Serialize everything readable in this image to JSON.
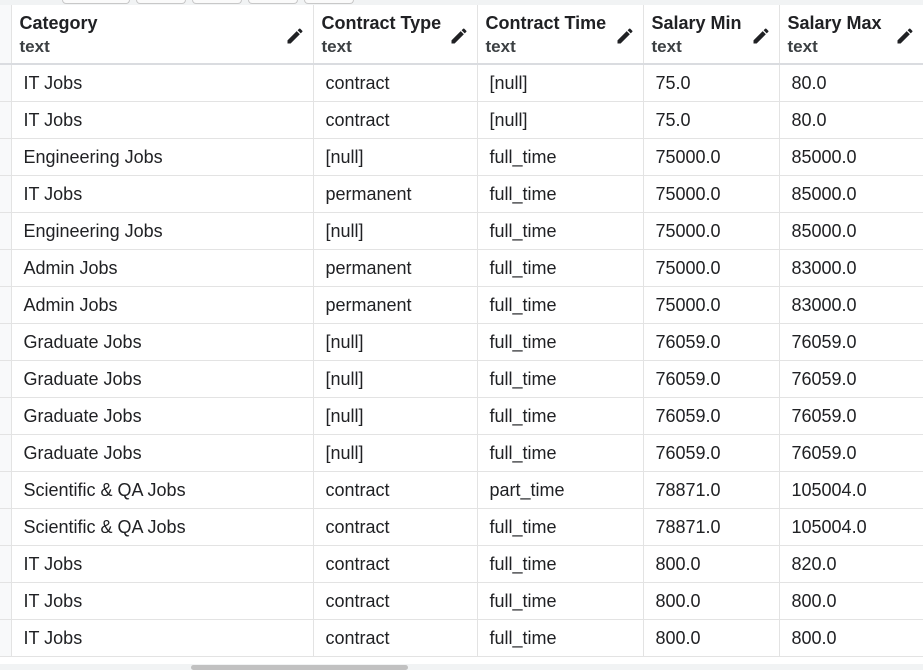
{
  "columns": [
    {
      "name": "Category",
      "type": "text"
    },
    {
      "name": "Contract Type",
      "type": "text"
    },
    {
      "name": "Contract Time",
      "type": "text"
    },
    {
      "name": "Salary Min",
      "type": "text"
    },
    {
      "name": "Salary Max",
      "type": "text"
    }
  ],
  "rows": [
    [
      "IT Jobs",
      "contract",
      "[null]",
      "75.0",
      "80.0"
    ],
    [
      "IT Jobs",
      "contract",
      "[null]",
      "75.0",
      "80.0"
    ],
    [
      "Engineering Jobs",
      "[null]",
      "full_time",
      "75000.0",
      "85000.0"
    ],
    [
      "IT Jobs",
      "permanent",
      "full_time",
      "75000.0",
      "85000.0"
    ],
    [
      "Engineering Jobs",
      "[null]",
      "full_time",
      "75000.0",
      "85000.0"
    ],
    [
      "Admin Jobs",
      "permanent",
      "full_time",
      "75000.0",
      "83000.0"
    ],
    [
      "Admin Jobs",
      "permanent",
      "full_time",
      "75000.0",
      "83000.0"
    ],
    [
      "Graduate Jobs",
      "[null]",
      "full_time",
      "76059.0",
      "76059.0"
    ],
    [
      "Graduate Jobs",
      "[null]",
      "full_time",
      "76059.0",
      "76059.0"
    ],
    [
      "Graduate Jobs",
      "[null]",
      "full_time",
      "76059.0",
      "76059.0"
    ],
    [
      "Graduate Jobs",
      "[null]",
      "full_time",
      "76059.0",
      "76059.0"
    ],
    [
      "Scientific & QA Jobs",
      "contract",
      "part_time",
      "78871.0",
      "105004.0"
    ],
    [
      "Scientific & QA Jobs",
      "contract",
      "full_time",
      "78871.0",
      "105004.0"
    ],
    [
      "IT Jobs",
      "contract",
      "full_time",
      "800.0",
      "820.0"
    ],
    [
      "IT Jobs",
      "contract",
      "full_time",
      "800.0",
      "800.0"
    ],
    [
      "IT Jobs",
      "contract",
      "full_time",
      "800.0",
      "800.0"
    ]
  ],
  "icons": {
    "column_edit": "pencil-icon"
  },
  "colors": {
    "grid_line": "#e3e3e3",
    "header_text": "#202124"
  }
}
